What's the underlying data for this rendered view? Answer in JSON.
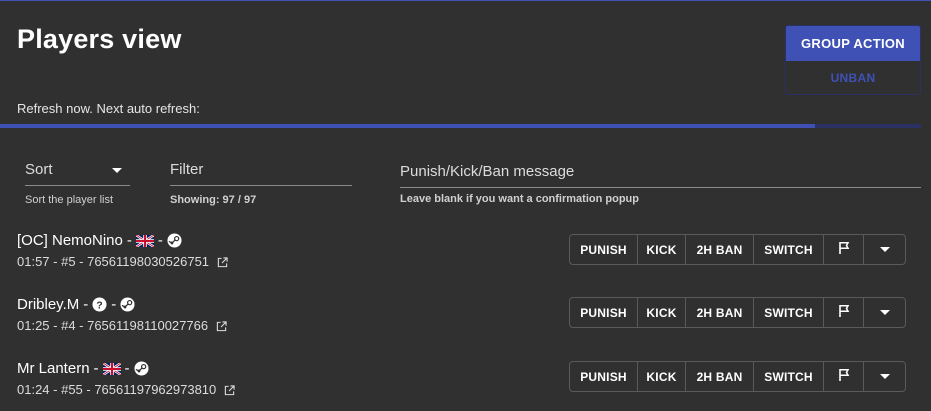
{
  "header": {
    "title": "Players view",
    "refresh_text": "Refresh now. Next auto refresh:",
    "progress_fraction": 0.885
  },
  "buttons": {
    "group_action": "GROUP ACTION",
    "unban": "UNBAN"
  },
  "controls": {
    "sort": {
      "value": "Sort",
      "helper": "Sort the player list"
    },
    "filter": {
      "value": "Filter",
      "helper": "Showing: 97 / 97"
    },
    "message": {
      "placeholder": "Punish/Kick/Ban message",
      "helper": "Leave blank if you want a confirmation popup"
    }
  },
  "row_actions": {
    "punish": "PUNISH",
    "kick": "KICK",
    "ban": "2H BAN",
    "switch": "SWITCH"
  },
  "players": [
    {
      "name": "[OC] NemoNino",
      "sep": "-",
      "country": "uk-flag",
      "platform": "steam-icon",
      "meta": "01:57 - #5 - 76561198030526751"
    },
    {
      "name": "Dribley.M",
      "sep": "-",
      "country": "unknown-icon",
      "platform": "steam-icon",
      "meta": "01:25 - #4 - 76561198110027766"
    },
    {
      "name": "Mr Lantern",
      "sep": "-",
      "country": "uk-flag",
      "platform": "steam-icon",
      "meta": "01:24 - #55 - 76561197962973810"
    }
  ],
  "colors": {
    "accent": "#3f51b5",
    "background": "#303030"
  }
}
